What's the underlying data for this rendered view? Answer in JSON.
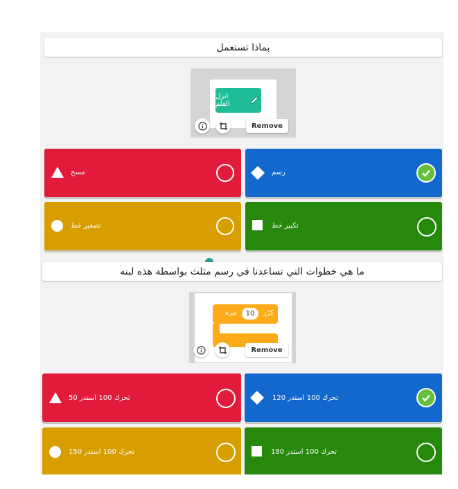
{
  "questions": [
    {
      "title": "بماذا تستعمل",
      "block_label": "انزل القلم",
      "remove_label": "Remove",
      "answers": [
        {
          "text": "مسح",
          "color": "#e21b3c",
          "shape": "triangle",
          "correct": false
        },
        {
          "text": "رسم",
          "color": "#1368ce",
          "shape": "diamond",
          "correct": true
        },
        {
          "text": "تصغير خط",
          "color": "#d89e00",
          "shape": "circle",
          "correct": false
        },
        {
          "text": "تكبير خط",
          "color": "#26890c",
          "shape": "square",
          "correct": false
        }
      ]
    },
    {
      "title": "ما هي خطوات التي تساعدنا في رسم مثلث بواسطة هذه لبنه",
      "block_label_repeat": "كرّر",
      "block_repeat_count": "10",
      "block_label_times": "مرة",
      "remove_label": "Remove",
      "answers": [
        {
          "text": "تحرك 100 استدر 50",
          "color": "#e21b3c",
          "shape": "triangle",
          "correct": false
        },
        {
          "text": "تحرك 100 استدر 120",
          "color": "#1368ce",
          "shape": "diamond",
          "correct": true
        },
        {
          "text": "تحرك 100 استدر 150",
          "color": "#d89e00",
          "shape": "circle",
          "correct": false
        },
        {
          "text": "تحرك 100 استدر 180",
          "color": "#26890c",
          "shape": "square",
          "correct": false
        }
      ]
    }
  ],
  "icons": {
    "info": "info-icon",
    "crop": "crop-icon",
    "check": "check-icon",
    "pencil": "pencil-icon"
  }
}
